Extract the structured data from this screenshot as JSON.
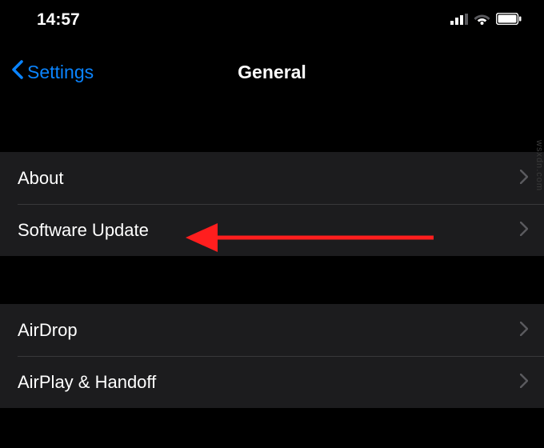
{
  "status": {
    "time": "14:57"
  },
  "nav": {
    "back": "Settings",
    "title": "General"
  },
  "group1": {
    "about": "About",
    "software_update": "Software Update"
  },
  "group2": {
    "airdrop": "AirDrop",
    "airplay_handoff": "AirPlay & Handoff"
  },
  "watermark": "wsxdn.com",
  "annotation": {
    "color": "#ff1e1e"
  }
}
